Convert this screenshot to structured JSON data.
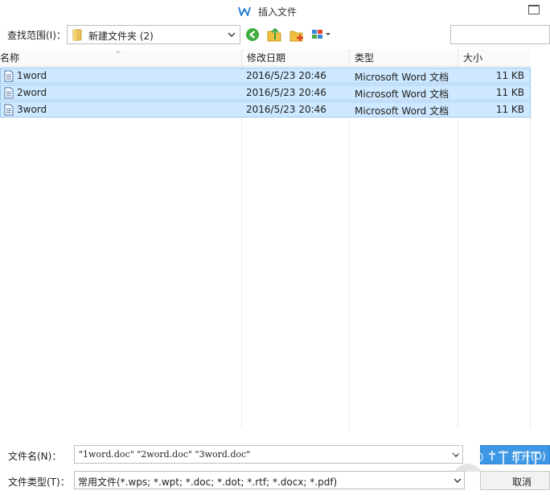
{
  "window": {
    "title": "插入文件"
  },
  "toolbar": {
    "lookin_label": "查找范围(I)：",
    "current_folder": "新建文件夹 (2)"
  },
  "columns": [
    "名称",
    "修改日期",
    "类型",
    "大小"
  ],
  "files": [
    {
      "name": "1word",
      "modified": "2016/5/23 20:46",
      "type": "Microsoft Word 文档",
      "size": "11 KB",
      "selected": true
    },
    {
      "name": "2word",
      "modified": "2016/5/23 20:46",
      "type": "Microsoft Word 文档",
      "size": "11 KB",
      "selected": true
    },
    {
      "name": "3word",
      "modified": "2016/5/23 20:46",
      "type": "Microsoft Word 文档",
      "size": "11 KB",
      "selected": true
    }
  ],
  "bottom": {
    "filename_label": "文件名(N)：",
    "filename_value": "\"1word.doc\" \"2word.doc\" \"3word.doc\"",
    "filetype_label": "文件类型(T)：",
    "filetype_value": "常用文件(*.wps; *.wpt; *.doc; *.dot; *.rtf; *.docx; *.pdf)",
    "open_label": "打开(O)",
    "cancel_label": "取消"
  },
  "colors": {
    "selection": "#cde8ff",
    "selection_border": "#99c8ef",
    "accent": "#3d97e4"
  },
  "icons": [
    "wps-writer-logo-icon",
    "maximize-icon",
    "folder-icon",
    "back-icon",
    "up-folder-icon",
    "new-folder-icon",
    "view-menu-icon",
    "word-doc-icon",
    "chevron-down-icon",
    "baidu-jingyan-watermark"
  ]
}
